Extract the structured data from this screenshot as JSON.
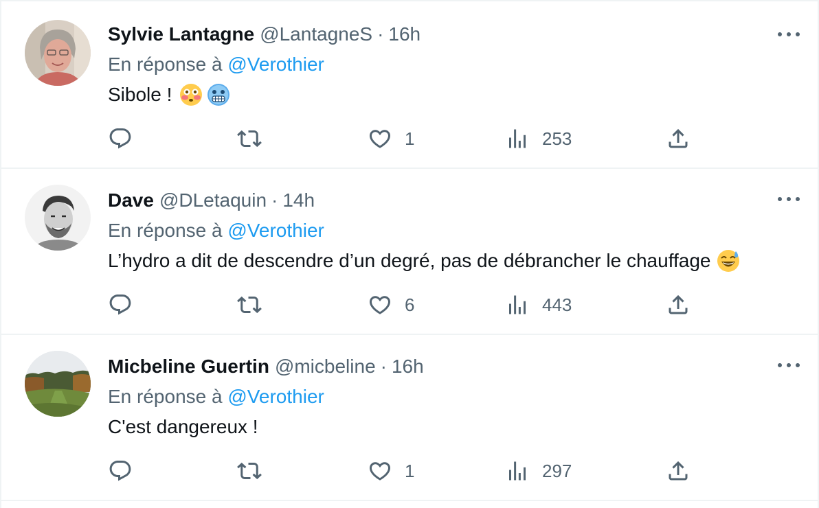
{
  "tweets": [
    {
      "name": "Sylvie Lantagne",
      "handle": "@LantagneS",
      "separator": "·",
      "time": "16h",
      "reply_prefix": "En réponse à",
      "reply_to": "@Verothier",
      "text": "Sibole !",
      "emojis": [
        "flushed-face-emoji",
        "cold-face-emoji"
      ],
      "replies": "",
      "retweets": "",
      "likes": "1",
      "views": "253"
    },
    {
      "name": "Dave",
      "handle": "@DLetaquin",
      "separator": "·",
      "time": "14h",
      "reply_prefix": "En réponse à",
      "reply_to": "@Verothier",
      "text": "L’hydro a dit de descendre d’un degré, pas de débrancher le chauffage",
      "emojis": [
        "grinning-sweat-face-emoji"
      ],
      "replies": "",
      "retweets": "",
      "likes": "6",
      "views": "443"
    },
    {
      "name": "Micbeline Guertin",
      "handle": "@micbeline",
      "separator": "·",
      "time": "16h",
      "reply_prefix": "En réponse à",
      "reply_to": "@Verothier",
      "text": "C'est dangereux !",
      "emojis": [],
      "replies": "",
      "retweets": "",
      "likes": "1",
      "views": "297"
    }
  ],
  "colors": {
    "text": "#0f1419",
    "secondary": "#536471",
    "accent": "#1d9bf0",
    "divider": "#eff3f4"
  },
  "icons": {
    "reply": "reply-icon",
    "retweet": "retweet-icon",
    "like": "heart-icon",
    "views": "views-icon",
    "share": "share-icon",
    "more": "more-icon"
  }
}
